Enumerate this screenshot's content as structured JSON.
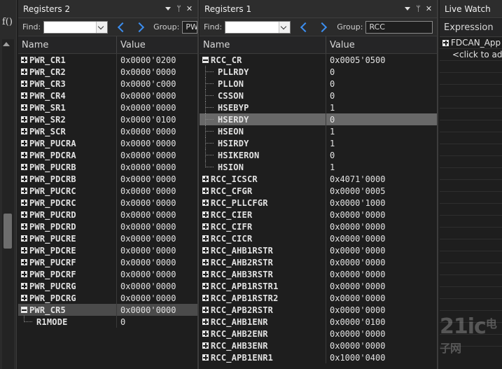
{
  "sidebar": {
    "fx_label": "f()"
  },
  "panels": {
    "left": {
      "title": "Registers 2",
      "find_label": "Find:",
      "find_value": "",
      "group_label": "Group:",
      "group_value": "PW",
      "col_name": "Name",
      "col_value": "Value",
      "rows": [
        {
          "name": "PWR_CR1",
          "value": "0x0000'0200"
        },
        {
          "name": "PWR_CR2",
          "value": "0x0000'0000"
        },
        {
          "name": "PWR_CR3",
          "value": "0x0000'c000"
        },
        {
          "name": "PWR_CR4",
          "value": "0x0000'0000"
        },
        {
          "name": "PWR_SR1",
          "value": "0x0000'0000"
        },
        {
          "name": "PWR_SR2",
          "value": "0x0000'0100"
        },
        {
          "name": "PWR_SCR",
          "value": "0x0000'0000"
        },
        {
          "name": "PWR_PUCRA",
          "value": "0x0000'0000"
        },
        {
          "name": "PWR_PDCRA",
          "value": "0x0000'0000"
        },
        {
          "name": "PWR_PUCRB",
          "value": "0x0000'0000"
        },
        {
          "name": "PWR_PDCRB",
          "value": "0x0000'0000"
        },
        {
          "name": "PWR_PUCRC",
          "value": "0x0000'0000"
        },
        {
          "name": "PWR_PDCRC",
          "value": "0x0000'0000"
        },
        {
          "name": "PWR_PUCRD",
          "value": "0x0000'0000"
        },
        {
          "name": "PWR_PDCRD",
          "value": "0x0000'0000"
        },
        {
          "name": "PWR_PUCRE",
          "value": "0x0000'0000"
        },
        {
          "name": "PWR_PDCRE",
          "value": "0x0000'0000"
        },
        {
          "name": "PWR_PUCRF",
          "value": "0x0000'0000"
        },
        {
          "name": "PWR_PDCRF",
          "value": "0x0000'0000"
        },
        {
          "name": "PWR_PUCRG",
          "value": "0x0000'0000"
        },
        {
          "name": "PWR_PDCRG",
          "value": "0x0000'0000"
        },
        {
          "name": "PWR_CR5",
          "value": "0x0000'0000"
        }
      ],
      "child": {
        "name": "R1MODE",
        "value": "0"
      }
    },
    "middle": {
      "title": "Registers 1",
      "find_label": "Find:",
      "find_value": "",
      "group_label": "Group:",
      "group_value": "RCC",
      "col_name": "Name",
      "col_value": "Value",
      "expanded": {
        "name": "RCC_CR",
        "value": "0x0005'0500"
      },
      "children": [
        {
          "name": "PLLRDY",
          "value": "0"
        },
        {
          "name": "PLLON",
          "value": "0"
        },
        {
          "name": "CSSON",
          "value": "0"
        },
        {
          "name": "HSEBYP",
          "value": "1"
        },
        {
          "name": "HSERDY",
          "value": "0"
        },
        {
          "name": "HSEON",
          "value": "1"
        },
        {
          "name": "HSIRDY",
          "value": "1"
        },
        {
          "name": "HSIKERON",
          "value": "0"
        },
        {
          "name": "HSION",
          "value": "1"
        }
      ],
      "rows": [
        {
          "name": "RCC_ICSCR",
          "value": "0x4071'0000"
        },
        {
          "name": "RCC_CFGR",
          "value": "0x0000'0005"
        },
        {
          "name": "RCC_PLLCFGR",
          "value": "0x0000'1000"
        },
        {
          "name": "RCC_CIER",
          "value": "0x0000'0000"
        },
        {
          "name": "RCC_CIFR",
          "value": "0x0000'0000"
        },
        {
          "name": "RCC_CICR",
          "value": "0x0000'0000"
        },
        {
          "name": "RCC_AHB1RSTR",
          "value": "0x0000'0000"
        },
        {
          "name": "RCC_AHB2RSTR",
          "value": "0x0000'0000"
        },
        {
          "name": "RCC_AHB3RSTR",
          "value": "0x0000'0000"
        },
        {
          "name": "RCC_APB1RSTR1",
          "value": "0x0000'0000"
        },
        {
          "name": "RCC_APB1RSTR2",
          "value": "0x0000'0000"
        },
        {
          "name": "RCC_APB2RSTR",
          "value": "0x0000'0000"
        },
        {
          "name": "RCC_AHB1ENR",
          "value": "0x0000'0100"
        },
        {
          "name": "RCC_AHB2ENR",
          "value": "0x0000'0000"
        },
        {
          "name": "RCC_AHB3ENR",
          "value": "0x0000'0000"
        },
        {
          "name": "RCC_APB1ENR1",
          "value": "0x1000'0400"
        }
      ]
    },
    "right": {
      "title": "Live Watch",
      "col_expression": "Expression",
      "item": "FDCAN_App",
      "click_to_add": "<click to add>"
    }
  },
  "watermark": {
    "main": "21ic",
    "cn": "电子网"
  }
}
